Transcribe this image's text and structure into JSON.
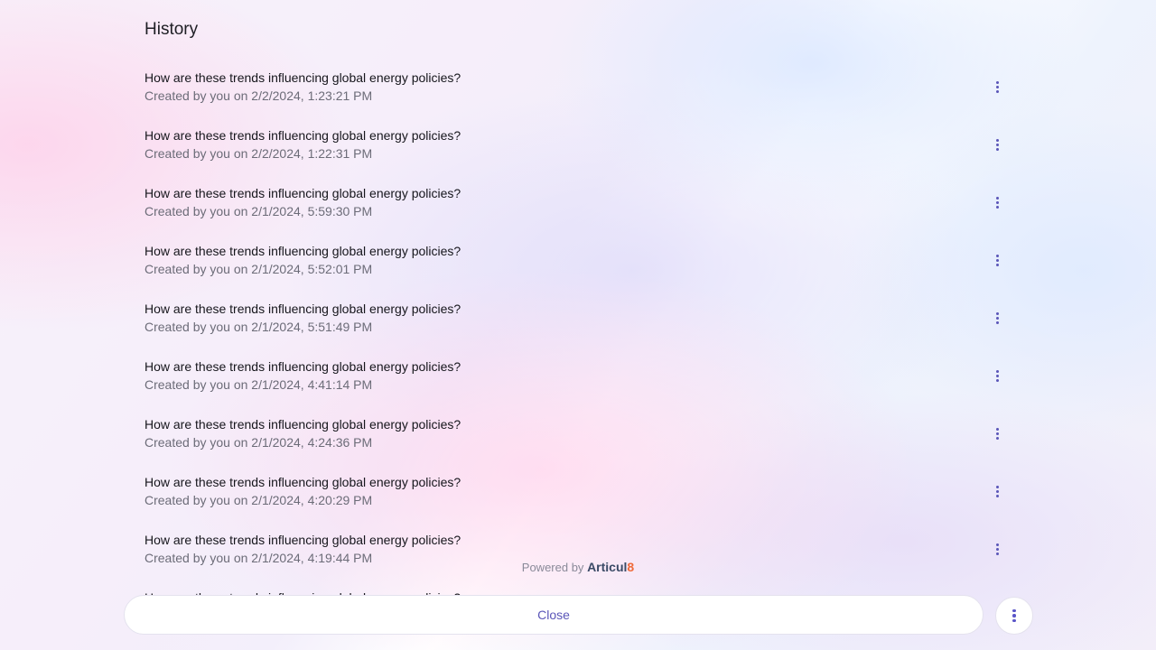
{
  "header": {
    "title": "History"
  },
  "history": {
    "items": [
      {
        "question": "How are these trends influencing global energy policies?",
        "meta": "Created by you on 2/2/2024, 1:23:21 PM",
        "menu_icon": "more-vertical-icon"
      },
      {
        "question": "How are these trends influencing global energy policies?",
        "meta": "Created by you on 2/2/2024, 1:22:31 PM",
        "menu_icon": "more-vertical-icon"
      },
      {
        "question": "How are these trends influencing global energy policies?",
        "meta": "Created by you on 2/1/2024, 5:59:30 PM",
        "menu_icon": "more-vertical-icon"
      },
      {
        "question": "How are these trends influencing global energy policies?",
        "meta": "Created by you on 2/1/2024, 5:52:01 PM",
        "menu_icon": "more-vertical-icon"
      },
      {
        "question": "How are these trends influencing global energy policies?",
        "meta": "Created by you on 2/1/2024, 5:51:49 PM",
        "menu_icon": "more-vertical-icon"
      },
      {
        "question": "How are these trends influencing global energy policies?",
        "meta": "Created by you on 2/1/2024, 4:41:14 PM",
        "menu_icon": "more-vertical-icon"
      },
      {
        "question": "How are these trends influencing global energy policies?",
        "meta": "Created by you on 2/1/2024, 4:24:36 PM",
        "menu_icon": "more-vertical-icon"
      },
      {
        "question": "How are these trends influencing global energy policies?",
        "meta": "Created by you on 2/1/2024, 4:20:29 PM",
        "menu_icon": "more-vertical-icon"
      },
      {
        "question": "How are these trends influencing global energy policies?",
        "meta": "Created by you on 2/1/2024, 4:19:44 PM",
        "menu_icon": "more-vertical-icon"
      },
      {
        "question": "How are these trends influencing global energy policies?",
        "meta": "",
        "menu_icon": "more-vertical-icon"
      }
    ]
  },
  "footer": {
    "powered_by_label": "Powered by",
    "brand_name": "Articul",
    "brand_accent": "8",
    "close_label": "Close",
    "menu_icon": "more-vertical-icon"
  },
  "colors": {
    "accent": "#5a55b8",
    "brand_text": "#3a4a66",
    "brand_accent": "#ef6a3a",
    "secondary_text": "#6c6c78"
  }
}
